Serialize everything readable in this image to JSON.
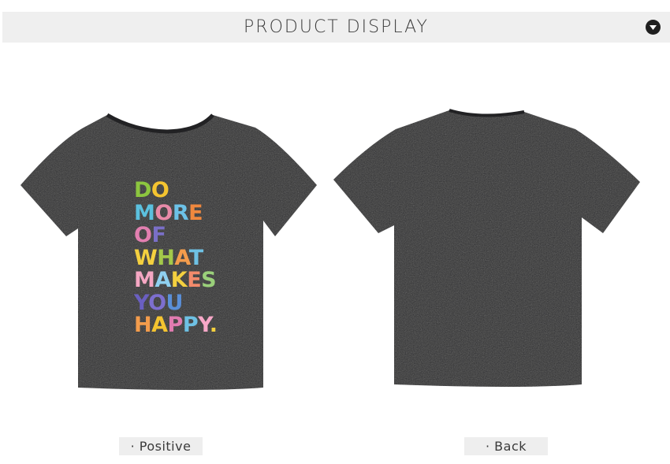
{
  "header": {
    "title": "PRODUCT  DISPLAY",
    "toggle_icon": "chevron-down-icon"
  },
  "front": {
    "label": "· Positive",
    "slogan": [
      {
        "text": "DO",
        "colors": [
          "#8cc63f",
          "#f4c430"
        ]
      },
      {
        "text": "MORE",
        "colors": [
          "#5bc0de",
          "#e88aa8",
          "#6cc2e8",
          "#f0883e"
        ]
      },
      {
        "text": "OF",
        "colors": [
          "#e27fb0",
          "#7a6fc7"
        ]
      },
      {
        "text": "WHAT",
        "colors": [
          "#f4d03f",
          "#a3c94a",
          "#f39c4c",
          "#6ec1e4"
        ]
      },
      {
        "text": "MAKES",
        "colors": [
          "#f5a7c3",
          "#8fd1f0",
          "#f4d03f",
          "#f28a6b",
          "#9ad07a"
        ]
      },
      {
        "text": "YOU",
        "colors": [
          "#6a5fc1",
          "#7d6fcf",
          "#5a8fd8"
        ]
      },
      {
        "text": "HAPPY.",
        "colors": [
          "#f39c4c",
          "#f4c430",
          "#e07bb0",
          "#6ec1e4",
          "#f7a8c8",
          "#f4d03f"
        ]
      }
    ]
  },
  "back": {
    "label": "· Back"
  },
  "colors": {
    "shirt": "#2b2b2d",
    "header_bg": "#efefef",
    "label_bg": "#eeeeee"
  }
}
